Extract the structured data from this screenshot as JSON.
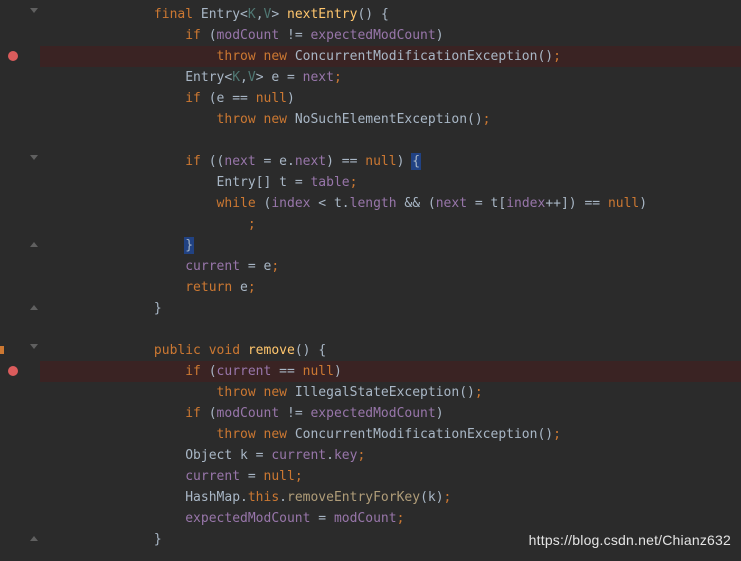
{
  "watermark": "https://blog.csdn.net/Chianz632",
  "lines": [
    {
      "tokens": [
        {
          "cls": "kw",
          "t": "final "
        },
        {
          "cls": "type",
          "t": "Entry"
        },
        {
          "cls": "op",
          "t": "<"
        },
        {
          "cls": "generic",
          "t": "K"
        },
        {
          "cls": "op",
          "t": ","
        },
        {
          "cls": "generic",
          "t": "V"
        },
        {
          "cls": "op",
          "t": "> "
        },
        {
          "cls": "methoddecl",
          "t": "nextEntry"
        },
        {
          "cls": "paren",
          "t": "() "
        },
        {
          "cls": "paren",
          "t": "{"
        }
      ],
      "indent": 3,
      "fold": "down"
    },
    {
      "tokens": [
        {
          "cls": "kw",
          "t": "if "
        },
        {
          "cls": "paren",
          "t": "("
        },
        {
          "cls": "field",
          "t": "modCount"
        },
        {
          "cls": "op",
          "t": " != "
        },
        {
          "cls": "field",
          "t": "expectedModCount"
        },
        {
          "cls": "paren",
          "t": ")"
        }
      ],
      "indent": 4
    },
    {
      "tokens": [
        {
          "cls": "kw",
          "t": "throw new "
        },
        {
          "cls": "type",
          "t": "ConcurrentModificationException"
        },
        {
          "cls": "paren",
          "t": "()"
        },
        {
          "cls": "semi",
          "t": ";"
        }
      ],
      "indent": 5,
      "breakpoint": true
    },
    {
      "tokens": [
        {
          "cls": "type",
          "t": "Entry"
        },
        {
          "cls": "op",
          "t": "<"
        },
        {
          "cls": "generic",
          "t": "K"
        },
        {
          "cls": "op",
          "t": ","
        },
        {
          "cls": "generic",
          "t": "V"
        },
        {
          "cls": "op",
          "t": "> "
        },
        {
          "cls": "ident",
          "t": "e"
        },
        {
          "cls": "op",
          "t": " = "
        },
        {
          "cls": "field",
          "t": "next"
        },
        {
          "cls": "semi",
          "t": ";"
        }
      ],
      "indent": 4
    },
    {
      "tokens": [
        {
          "cls": "kw",
          "t": "if "
        },
        {
          "cls": "paren",
          "t": "("
        },
        {
          "cls": "ident",
          "t": "e"
        },
        {
          "cls": "op",
          "t": " == "
        },
        {
          "cls": "kw",
          "t": "null"
        },
        {
          "cls": "paren",
          "t": ")"
        }
      ],
      "indent": 4
    },
    {
      "tokens": [
        {
          "cls": "kw",
          "t": "throw new "
        },
        {
          "cls": "type",
          "t": "NoSuchElementException"
        },
        {
          "cls": "paren",
          "t": "()"
        },
        {
          "cls": "semi",
          "t": ";"
        }
      ],
      "indent": 5
    },
    {
      "tokens": [],
      "indent": 0
    },
    {
      "tokens": [
        {
          "cls": "kw",
          "t": "if "
        },
        {
          "cls": "paren",
          "t": "(("
        },
        {
          "cls": "field",
          "t": "next"
        },
        {
          "cls": "op",
          "t": " = "
        },
        {
          "cls": "ident",
          "t": "e."
        },
        {
          "cls": "field",
          "t": "next"
        },
        {
          "cls": "paren",
          "t": ") "
        },
        {
          "cls": "op",
          "t": "== "
        },
        {
          "cls": "kw",
          "t": "null"
        },
        {
          "cls": "paren",
          "t": ") "
        },
        {
          "cls": "paren hl-box",
          "t": "{"
        }
      ],
      "indent": 4,
      "fold": "down"
    },
    {
      "tokens": [
        {
          "cls": "type",
          "t": "Entry"
        },
        {
          "cls": "paren",
          "t": "[] "
        },
        {
          "cls": "ident",
          "t": "t"
        },
        {
          "cls": "op",
          "t": " = "
        },
        {
          "cls": "field",
          "t": "table"
        },
        {
          "cls": "semi",
          "t": ";"
        }
      ],
      "indent": 5
    },
    {
      "tokens": [
        {
          "cls": "kw",
          "t": "while "
        },
        {
          "cls": "paren",
          "t": "("
        },
        {
          "cls": "field",
          "t": "index"
        },
        {
          "cls": "op",
          "t": " < "
        },
        {
          "cls": "ident",
          "t": "t."
        },
        {
          "cls": "field",
          "t": "length"
        },
        {
          "cls": "op",
          "t": " && "
        },
        {
          "cls": "paren",
          "t": "("
        },
        {
          "cls": "field",
          "t": "next"
        },
        {
          "cls": "op",
          "t": " = "
        },
        {
          "cls": "ident",
          "t": "t"
        },
        {
          "cls": "paren",
          "t": "["
        },
        {
          "cls": "field",
          "t": "index"
        },
        {
          "cls": "op",
          "t": "++"
        },
        {
          "cls": "paren",
          "t": "]) "
        },
        {
          "cls": "op",
          "t": "== "
        },
        {
          "cls": "kw",
          "t": "null"
        },
        {
          "cls": "paren",
          "t": ")"
        }
      ],
      "indent": 5
    },
    {
      "tokens": [
        {
          "cls": "semi",
          "t": ";"
        }
      ],
      "indent": 6
    },
    {
      "tokens": [
        {
          "cls": "paren hl-box",
          "t": "}"
        }
      ],
      "indent": 4,
      "fold": "up"
    },
    {
      "tokens": [
        {
          "cls": "field",
          "t": "current"
        },
        {
          "cls": "op",
          "t": " = "
        },
        {
          "cls": "ident",
          "t": "e"
        },
        {
          "cls": "semi",
          "t": ";"
        }
      ],
      "indent": 4
    },
    {
      "tokens": [
        {
          "cls": "kw",
          "t": "return "
        },
        {
          "cls": "ident",
          "t": "e"
        },
        {
          "cls": "semi",
          "t": ";"
        }
      ],
      "indent": 4
    },
    {
      "tokens": [
        {
          "cls": "paren",
          "t": "}"
        }
      ],
      "indent": 3,
      "fold": "up"
    },
    {
      "tokens": [],
      "indent": 0
    },
    {
      "tokens": [
        {
          "cls": "kw",
          "t": "public "
        },
        {
          "cls": "kw",
          "t": "void "
        },
        {
          "cls": "methoddecl",
          "t": "remove"
        },
        {
          "cls": "paren",
          "t": "() "
        },
        {
          "cls": "paren",
          "t": "{"
        }
      ],
      "indent": 3,
      "fold": "down",
      "orangeTick": true
    },
    {
      "tokens": [
        {
          "cls": "kw",
          "t": "if "
        },
        {
          "cls": "paren",
          "t": "("
        },
        {
          "cls": "field",
          "t": "current"
        },
        {
          "cls": "op",
          "t": " == "
        },
        {
          "cls": "kw",
          "t": "null"
        },
        {
          "cls": "paren",
          "t": ")"
        }
      ],
      "indent": 4,
      "breakpoint": true
    },
    {
      "tokens": [
        {
          "cls": "kw",
          "t": "throw new "
        },
        {
          "cls": "type",
          "t": "IllegalStateException"
        },
        {
          "cls": "paren",
          "t": "()"
        },
        {
          "cls": "semi",
          "t": ";"
        }
      ],
      "indent": 5
    },
    {
      "tokens": [
        {
          "cls": "kw",
          "t": "if "
        },
        {
          "cls": "paren",
          "t": "("
        },
        {
          "cls": "field",
          "t": "modCount"
        },
        {
          "cls": "op",
          "t": " != "
        },
        {
          "cls": "field",
          "t": "expectedModCount"
        },
        {
          "cls": "paren",
          "t": ")"
        }
      ],
      "indent": 4
    },
    {
      "tokens": [
        {
          "cls": "kw",
          "t": "throw new "
        },
        {
          "cls": "type",
          "t": "ConcurrentModificationException"
        },
        {
          "cls": "paren",
          "t": "()"
        },
        {
          "cls": "semi",
          "t": ";"
        }
      ],
      "indent": 5
    },
    {
      "tokens": [
        {
          "cls": "type",
          "t": "Object "
        },
        {
          "cls": "ident",
          "t": "k"
        },
        {
          "cls": "op",
          "t": " = "
        },
        {
          "cls": "field",
          "t": "current"
        },
        {
          "cls": "op",
          "t": "."
        },
        {
          "cls": "field",
          "t": "key"
        },
        {
          "cls": "semi",
          "t": ";"
        }
      ],
      "indent": 4
    },
    {
      "tokens": [
        {
          "cls": "field",
          "t": "current"
        },
        {
          "cls": "op",
          "t": " = "
        },
        {
          "cls": "kw",
          "t": "null"
        },
        {
          "cls": "semi",
          "t": ";"
        }
      ],
      "indent": 4
    },
    {
      "tokens": [
        {
          "cls": "type",
          "t": "HashMap"
        },
        {
          "cls": "op",
          "t": "."
        },
        {
          "cls": "kw",
          "t": "this"
        },
        {
          "cls": "op",
          "t": "."
        },
        {
          "cls": "method",
          "t": "removeEntryForKey"
        },
        {
          "cls": "paren",
          "t": "("
        },
        {
          "cls": "ident",
          "t": "k"
        },
        {
          "cls": "paren",
          "t": ")"
        },
        {
          "cls": "semi",
          "t": ";"
        }
      ],
      "indent": 4
    },
    {
      "tokens": [
        {
          "cls": "field",
          "t": "expectedModCount"
        },
        {
          "cls": "op",
          "t": " = "
        },
        {
          "cls": "field",
          "t": "modCount"
        },
        {
          "cls": "semi",
          "t": ";"
        }
      ],
      "indent": 4
    },
    {
      "tokens": [
        {
          "cls": "paren",
          "t": "}"
        }
      ],
      "indent": 3,
      "fold": "up"
    }
  ]
}
